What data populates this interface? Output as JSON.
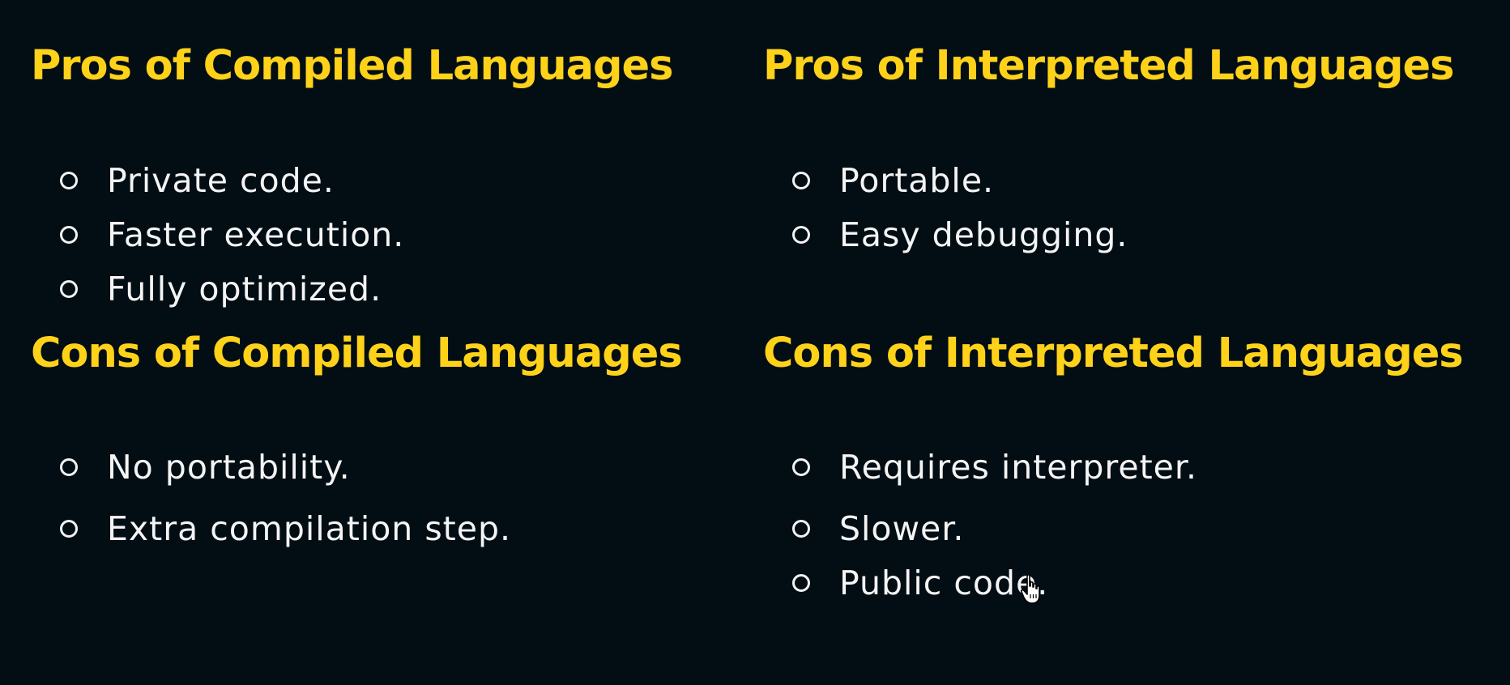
{
  "colors": {
    "background": "#020e14",
    "heading": "#ffd21a",
    "text": "#f4f4f4"
  },
  "sections": {
    "compiled_pros": {
      "title": "Pros of Compiled Languages",
      "items": [
        "Private code.",
        "Faster execution.",
        "Fully optimized."
      ]
    },
    "interpreted_pros": {
      "title": "Pros of Interpreted Languages",
      "items": [
        "Portable.",
        "Easy debugging."
      ]
    },
    "compiled_cons": {
      "title": "Cons of Compiled Languages",
      "items": [
        "No portability.",
        "Extra compilation step."
      ]
    },
    "interpreted_cons": {
      "title": "Cons of Interpreted Languages",
      "items": [
        "Requires interpreter.",
        "Slower.",
        "Public code."
      ]
    }
  },
  "icons": {
    "bullet": "hollow-circle-bullet-icon",
    "cursor": "hand-pointer-cursor-icon"
  }
}
